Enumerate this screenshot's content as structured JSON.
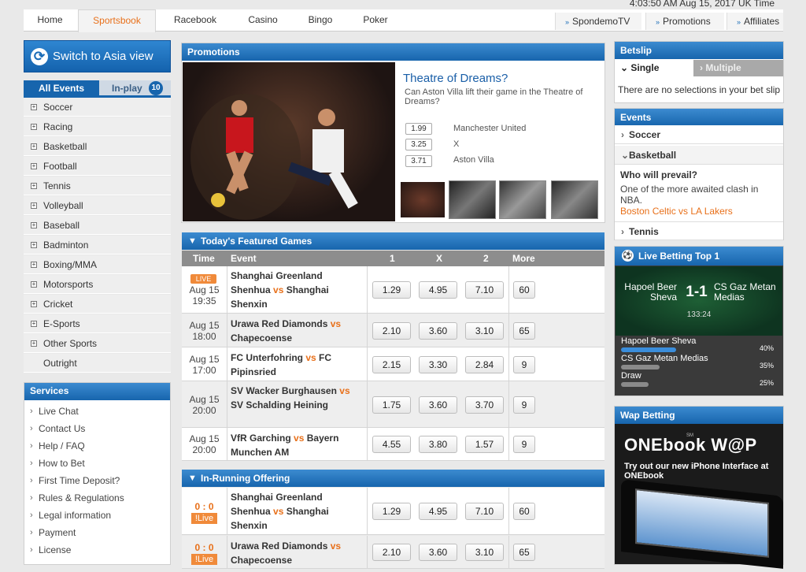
{
  "header": {
    "clock": "4:03:50 AM Aug 15, 2017 UK Time",
    "nav_tabs": [
      "Home",
      "Sportsbook",
      "Racebook",
      "Casino",
      "Bingo",
      "Poker"
    ],
    "nav_links": [
      "SpondemoTV",
      "Promotions",
      "Affiliates"
    ]
  },
  "left": {
    "asia_button": "Switch to Asia view",
    "tab_all": "All Events",
    "tab_inplay": "In-play",
    "inplay_count": "10",
    "sports": [
      "Soccer",
      "Racing",
      "Basketball",
      "Football",
      "Tennis",
      "Volleyball",
      "Baseball",
      "Badminton",
      "Boxing/MMA",
      "Motorsports",
      "Cricket",
      "E-Sports",
      "Other Sports"
    ],
    "outright": "Outright",
    "services_title": "Services",
    "services": [
      "Live Chat",
      "Contact Us",
      "Help / FAQ",
      "How to Bet",
      "First Time Deposit?",
      "Rules & Regulations",
      "Legal information",
      "Payment",
      "License"
    ]
  },
  "promo": {
    "title": "Promotions",
    "headline": "Theatre of Dreams?",
    "desc": "Can Aston Villa lift their game in the Theatre of Dreams?",
    "odds": [
      {
        "price": "1.99",
        "label": "Manchester United"
      },
      {
        "price": "3.25",
        "label": "X"
      },
      {
        "price": "3.71",
        "label": "Aston Villa"
      }
    ]
  },
  "featured": {
    "title": "Today's Featured Games",
    "columns": {
      "time": "Time",
      "event": "Event",
      "c1": "1",
      "cx": "X",
      "c2": "2",
      "more": "More"
    },
    "games": [
      {
        "live": "LIVE",
        "date": "Aug 15",
        "time": "19:35",
        "home": "Shanghai Greenland Shenhua",
        "vs": "vs",
        "away": "Shanghai Shenxin",
        "o1": "1.29",
        "ox": "4.95",
        "o2": "7.10",
        "more": "60"
      },
      {
        "date": "Aug 15",
        "time": "18:00",
        "home": "Urawa Red Diamonds",
        "vs": "vs",
        "away": "Chapecoense",
        "o1": "2.10",
        "ox": "3.60",
        "o2": "3.10",
        "more": "65"
      },
      {
        "date": "Aug 15",
        "time": "17:00",
        "home": "FC Unterfohring",
        "vs": "vs",
        "away": "FC Pipinsried",
        "o1": "2.15",
        "ox": "3.30",
        "o2": "2.84",
        "more": "9"
      },
      {
        "date": "Aug 15",
        "time": "20:00",
        "home": "SV Wacker Burghausen",
        "vs": "vs",
        "away": "SV Schalding Heining",
        "o1": "1.75",
        "ox": "3.60",
        "o2": "3.70",
        "more": "9"
      },
      {
        "date": "Aug 15",
        "time": "20:00",
        "home": "VfR Garching",
        "vs": "vs",
        "away": "Bayern Munchen AM",
        "o1": "4.55",
        "ox": "3.80",
        "o2": "1.57",
        "more": "9"
      }
    ]
  },
  "inrunning": {
    "title": "In-Running Offering",
    "live_label": "!Live",
    "games": [
      {
        "score": "0 : 0",
        "home": "Shanghai Greenland Shenhua",
        "vs": "vs",
        "away": "Shanghai Shenxin",
        "o1": "1.29",
        "ox": "4.95",
        "o2": "7.10",
        "more": "60"
      },
      {
        "score": "0 : 0",
        "home": "Urawa Red Diamonds",
        "vs": "vs",
        "away": "Chapecoense",
        "o1": "2.10",
        "ox": "3.60",
        "o2": "3.10",
        "more": "65"
      }
    ]
  },
  "betslip": {
    "title": "Betslip",
    "tab_single": "Single",
    "tab_multiple": "Multiple",
    "empty": "There are no selections in your bet slip"
  },
  "events": {
    "title": "Events",
    "soccer": "Soccer",
    "basketball": "Basketball",
    "question": "Who will prevail?",
    "desc": "One of the more awaited clash in NBA.",
    "link": "Boston Celtic vs LA Lakers",
    "tennis": "Tennis"
  },
  "live_top": {
    "title": "Live Betting Top 1",
    "home": "Hapoel Beer Sheva",
    "away": "CS Gaz Metan Medias",
    "score": "1-1",
    "clock": "133:24",
    "bars": [
      {
        "label": "Hapoel Beer Sheva",
        "pct": "40%",
        "value": 0.4
      },
      {
        "label": "CS Gaz Metan Medias",
        "pct": "35%",
        "value": 0.35
      },
      {
        "label": "Draw",
        "pct": "25%",
        "value": 0.25
      }
    ]
  },
  "wap": {
    "title": "Wap Betting",
    "brand": "ONEbook W@P",
    "sm": "SM",
    "desc": "Try out our new iPhone Interface at ONEbook"
  },
  "colors": {
    "accent": "#e8701a",
    "blue": "#1765ad",
    "bar_active": "#3a8ddb"
  }
}
